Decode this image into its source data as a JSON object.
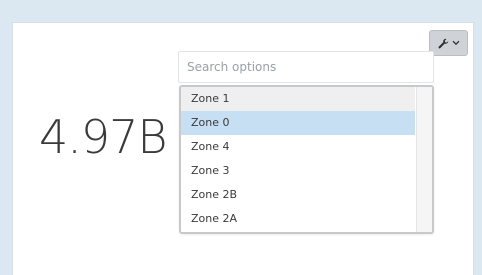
{
  "widget": {
    "metric_value": "4.97B"
  },
  "toolbar": {
    "settings_icon": "wrench-icon",
    "dropdown_icon": "chevron-down-icon"
  },
  "search": {
    "placeholder": "Search options",
    "value": ""
  },
  "dropdown": {
    "options": [
      {
        "label": "Zone 1",
        "state": "hover"
      },
      {
        "label": "Zone 0",
        "state": "selected"
      },
      {
        "label": "Zone 4",
        "state": "normal"
      },
      {
        "label": "Zone 3",
        "state": "normal"
      },
      {
        "label": "Zone 2B",
        "state": "normal"
      },
      {
        "label": "Zone 2A",
        "state": "normal"
      }
    ]
  },
  "colors": {
    "background": "#dbe7f1",
    "selected_row": "#c6dff2",
    "hover_row": "#efefef",
    "button": "#cfd3d8"
  }
}
